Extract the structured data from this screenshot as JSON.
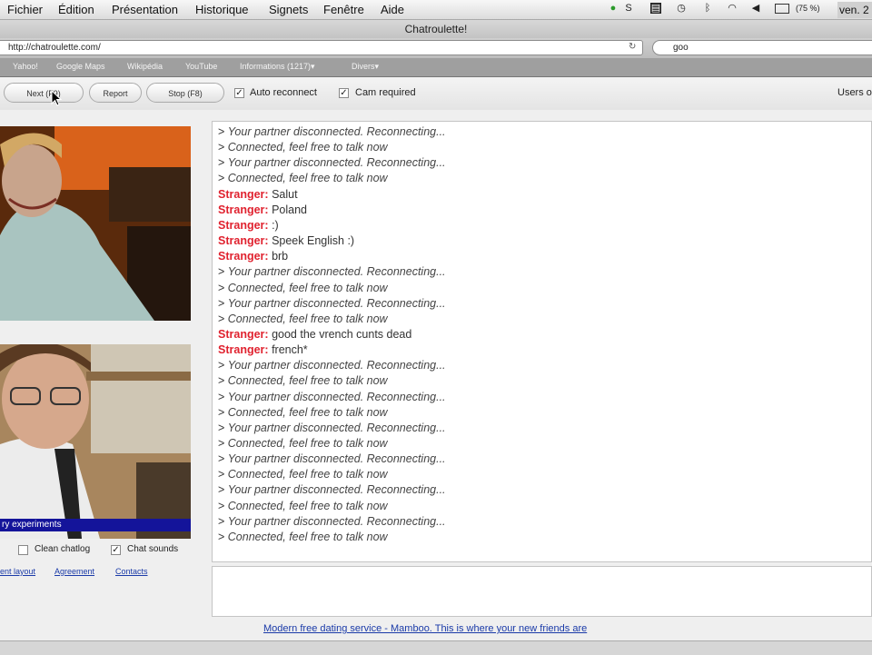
{
  "menubar": {
    "menus": [
      "Fichier",
      "Édition",
      "Présentation",
      "Historique",
      "Signets",
      "Fenêtre",
      "Aide"
    ],
    "clock": "ven. 2",
    "battery": "(75 %)"
  },
  "window": {
    "title": "Chatroulette!"
  },
  "toolbar": {
    "url": "http://chatroulette.com/",
    "search_value": "goo"
  },
  "bookmarks": [
    "Yahoo!",
    "Google Maps",
    "Wikipédia",
    "YouTube",
    "Informations (1217)▾",
    "Divers▾"
  ],
  "controls": {
    "next_label": "Next (F9)",
    "report_label": "Report",
    "stop_label": "Stop (F8)",
    "auto_reconnect_label": "Auto reconnect",
    "cam_required_label": "Cam required",
    "users_label": "Users o"
  },
  "cam": {
    "caption": "ry experiments"
  },
  "options": {
    "clean_chatlog_label": "Clean chatlog",
    "chat_sounds_label": "Chat sounds"
  },
  "footer_links": [
    "ent layout",
    "Agreement",
    "Contacts"
  ],
  "chat": {
    "lines": [
      {
        "type": "sys",
        "text": "Your partner disconnected. Reconnecting..."
      },
      {
        "type": "sys",
        "text": "Connected, feel free to talk now"
      },
      {
        "type": "sys",
        "text": "Your partner disconnected. Reconnecting..."
      },
      {
        "type": "sys",
        "text": "Connected, feel free to talk now"
      },
      {
        "type": "msg",
        "who": "Stranger:",
        "text": "Salut"
      },
      {
        "type": "msg",
        "who": "Stranger:",
        "text": "Poland"
      },
      {
        "type": "msg",
        "who": "Stranger:",
        "text": ":)"
      },
      {
        "type": "msg",
        "who": "Stranger:",
        "text": "Speek English :)"
      },
      {
        "type": "msg",
        "who": "Stranger:",
        "text": "brb"
      },
      {
        "type": "sys",
        "text": "Your partner disconnected. Reconnecting..."
      },
      {
        "type": "sys",
        "text": "Connected, feel free to talk now"
      },
      {
        "type": "sys",
        "text": "Your partner disconnected. Reconnecting..."
      },
      {
        "type": "sys",
        "text": "Connected, feel free to talk now"
      },
      {
        "type": "msg",
        "who": "Stranger:",
        "text": "good the vrench cunts dead"
      },
      {
        "type": "msg",
        "who": "Stranger:",
        "text": "french*"
      },
      {
        "type": "sys",
        "text": "Your partner disconnected. Reconnecting..."
      },
      {
        "type": "sys",
        "text": "Connected, feel free to talk now"
      },
      {
        "type": "sys",
        "text": "Your partner disconnected. Reconnecting..."
      },
      {
        "type": "sys",
        "text": "Connected, feel free to talk now"
      },
      {
        "type": "sys",
        "text": "Your partner disconnected. Reconnecting..."
      },
      {
        "type": "sys",
        "text": "Connected, feel free to talk now"
      },
      {
        "type": "sys",
        "text": "Your partner disconnected. Reconnecting..."
      },
      {
        "type": "sys",
        "text": "Connected, feel free to talk now"
      },
      {
        "type": "sys",
        "text": "Your partner disconnected. Reconnecting..."
      },
      {
        "type": "sys",
        "text": "Connected, feel free to talk now"
      },
      {
        "type": "sys",
        "text": "Your partner disconnected. Reconnecting..."
      },
      {
        "type": "sys",
        "text": "Connected, feel free to talk now"
      }
    ]
  },
  "ad": {
    "text": "Modern free dating service - Mamboo. This is where your new friends are"
  },
  "colors": {
    "stranger": "#e0222f",
    "link": "#1a3aa8",
    "caption_bg": "#14149a"
  }
}
